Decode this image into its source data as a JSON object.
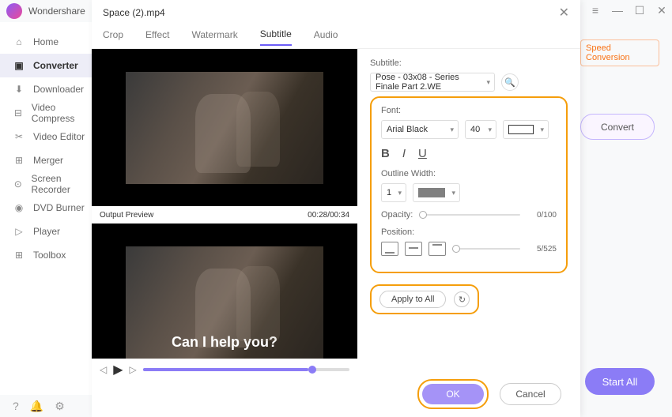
{
  "app": {
    "brand": "Wondershare"
  },
  "win": {
    "menu": "≡",
    "min": "—",
    "max": "☐",
    "close": "✕"
  },
  "sidebar": {
    "items": [
      {
        "label": "Home",
        "icon": "home"
      },
      {
        "label": "Converter",
        "icon": "convert"
      },
      {
        "label": "Downloader",
        "icon": "download"
      },
      {
        "label": "Video Compress",
        "icon": "compress"
      },
      {
        "label": "Video Editor",
        "icon": "editor"
      },
      {
        "label": "Merger",
        "icon": "merger"
      },
      {
        "label": "Screen Recorder",
        "icon": "record"
      },
      {
        "label": "DVD Burner",
        "icon": "dvd"
      },
      {
        "label": "Player",
        "icon": "play"
      },
      {
        "label": "Toolbox",
        "icon": "toolbox"
      }
    ]
  },
  "main": {
    "speed_link": "Speed Conversion",
    "convert_btn": "Convert",
    "start_all": "Start All"
  },
  "dialog": {
    "title": "Space (2).mp4",
    "tabs": [
      "Crop",
      "Effect",
      "Watermark",
      "Subtitle",
      "Audio"
    ],
    "active_tab": 3,
    "preview_label": "Output Preview",
    "time": "00:28/00:34",
    "subtitle_sample": "Can I help you?"
  },
  "settings": {
    "subtitle_label": "Subtitle:",
    "subtitle_value": "Pose - 03x08 - Series Finale Part 2.WE",
    "font_label": "Font:",
    "font_value": "Arial Black",
    "font_size": "40",
    "outline_label": "Outline Width:",
    "outline_value": "1",
    "opacity_label": "Opacity:",
    "opacity_value": "0/100",
    "position_label": "Position:",
    "position_value": "5/525",
    "apply_all": "Apply to All",
    "ok": "OK",
    "cancel": "Cancel"
  }
}
